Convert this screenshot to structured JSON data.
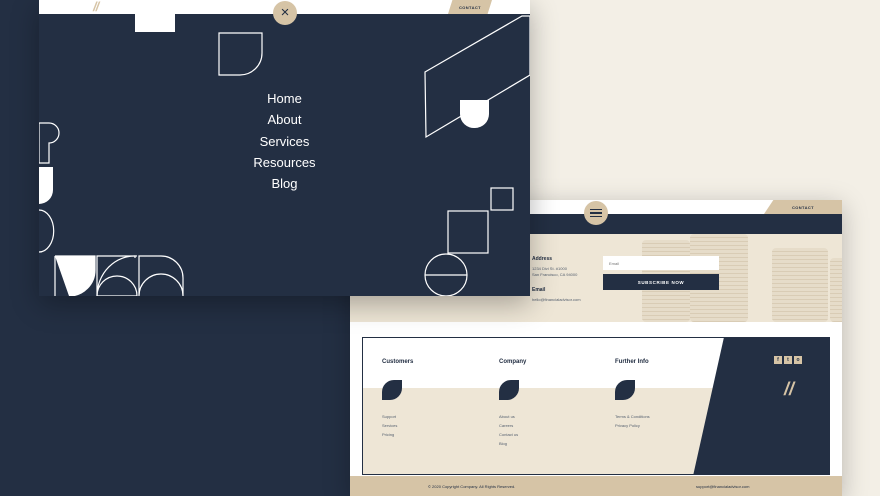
{
  "overlay": {
    "close_icon": "×",
    "logo_mark": "//",
    "contact_label": "CONTACT",
    "menu": [
      "Home",
      "About",
      "Services",
      "Resources",
      "Blog"
    ]
  },
  "site": {
    "contact_label": "CONTACT",
    "address_title": "Address",
    "address_line1": "1234 Divi St. #1000",
    "address_line2": "San Francisco, CA 94000",
    "email_title": "Email",
    "email_value": "hello@financialadvisor.com",
    "email_placeholder": "Email",
    "subscribe_label": "SUBSCRIBE NOW",
    "footer": {
      "customers_title": "Customers",
      "customers_links": [
        "Support",
        "Services",
        "Pricing"
      ],
      "company_title": "Company",
      "company_links": [
        "About us",
        "Careers",
        "Contact us",
        "Blog"
      ],
      "info_title": "Further Info",
      "info_links": [
        "Terms & Conditions",
        "Privacy Policy"
      ],
      "social": [
        "f",
        "t",
        "o"
      ],
      "quote_mark": "//"
    },
    "copyright": "© 2020 Copyright Company. All Rights Reserved.",
    "footer_email": "support@financialadvisor.com"
  },
  "colors": {
    "navy": "#232f43",
    "sand": "#d6c4a6",
    "cream": "#eee6d6"
  }
}
